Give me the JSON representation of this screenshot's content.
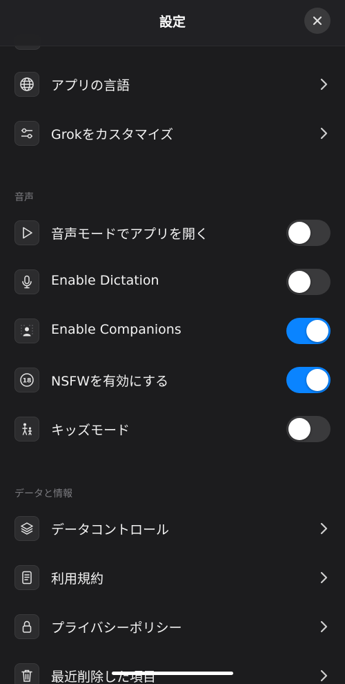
{
  "header": {
    "title": "設定"
  },
  "general_rows": [
    {
      "label": "アプリの言語",
      "icon": "globe-icon"
    },
    {
      "label": "Grokをカスタマイズ",
      "icon": "sliders-icon"
    }
  ],
  "voice_section": {
    "header": "音声",
    "rows": [
      {
        "label": "音声モードでアプリを開く",
        "icon": "play-icon",
        "toggle_on": false
      },
      {
        "label": "Enable Dictation",
        "icon": "microphone-icon",
        "toggle_on": false
      },
      {
        "label": "Enable Companions",
        "icon": "companion-person-icon",
        "toggle_on": true
      },
      {
        "label": "NSFWを有効にする",
        "icon": "age-18-icon",
        "toggle_on": true
      },
      {
        "label": "キッズモード",
        "icon": "parent-child-icon",
        "toggle_on": false
      }
    ]
  },
  "data_section": {
    "header": "データと情報",
    "rows": [
      {
        "label": "データコントロール",
        "icon": "layers-icon"
      },
      {
        "label": "利用規約",
        "icon": "document-icon"
      },
      {
        "label": "プライバシーポリシー",
        "icon": "lock-icon"
      },
      {
        "label": "最近削除した項目",
        "icon": "trash-icon"
      }
    ]
  },
  "colors": {
    "background": "#1c1c1e",
    "toggle_on": "#0a84ff",
    "toggle_off": "#3a3a3c",
    "section_header": "#7c7c80"
  }
}
